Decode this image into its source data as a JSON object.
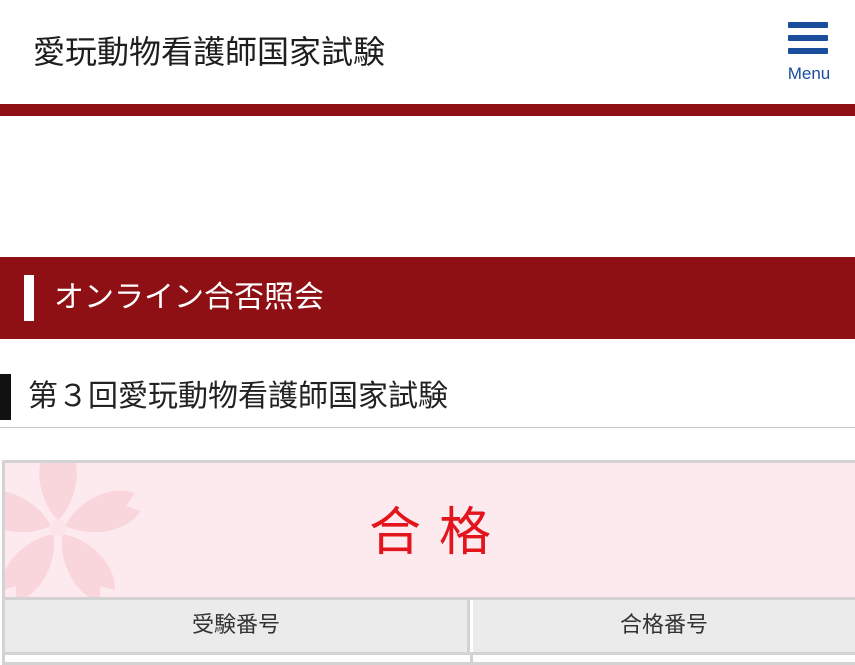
{
  "header": {
    "site_title": "愛玩動物看護師国家試験",
    "menu_label": "Menu",
    "menu_icon": "hamburger-menu-icon"
  },
  "section": {
    "title": "オンライン合否照会"
  },
  "exam": {
    "title": "第３回愛玩動物看護師国家試験"
  },
  "result": {
    "status": "合格",
    "decoration_icon": "sakura-flower-icon",
    "columns": [
      "受験番号",
      "合格番号"
    ]
  },
  "colors": {
    "brand_red": "#8e0f14",
    "menu_blue": "#1a4d9c",
    "pass_red": "#e3141b",
    "result_bg": "#fdeaee",
    "header_cell_bg": "#ebebeb"
  }
}
